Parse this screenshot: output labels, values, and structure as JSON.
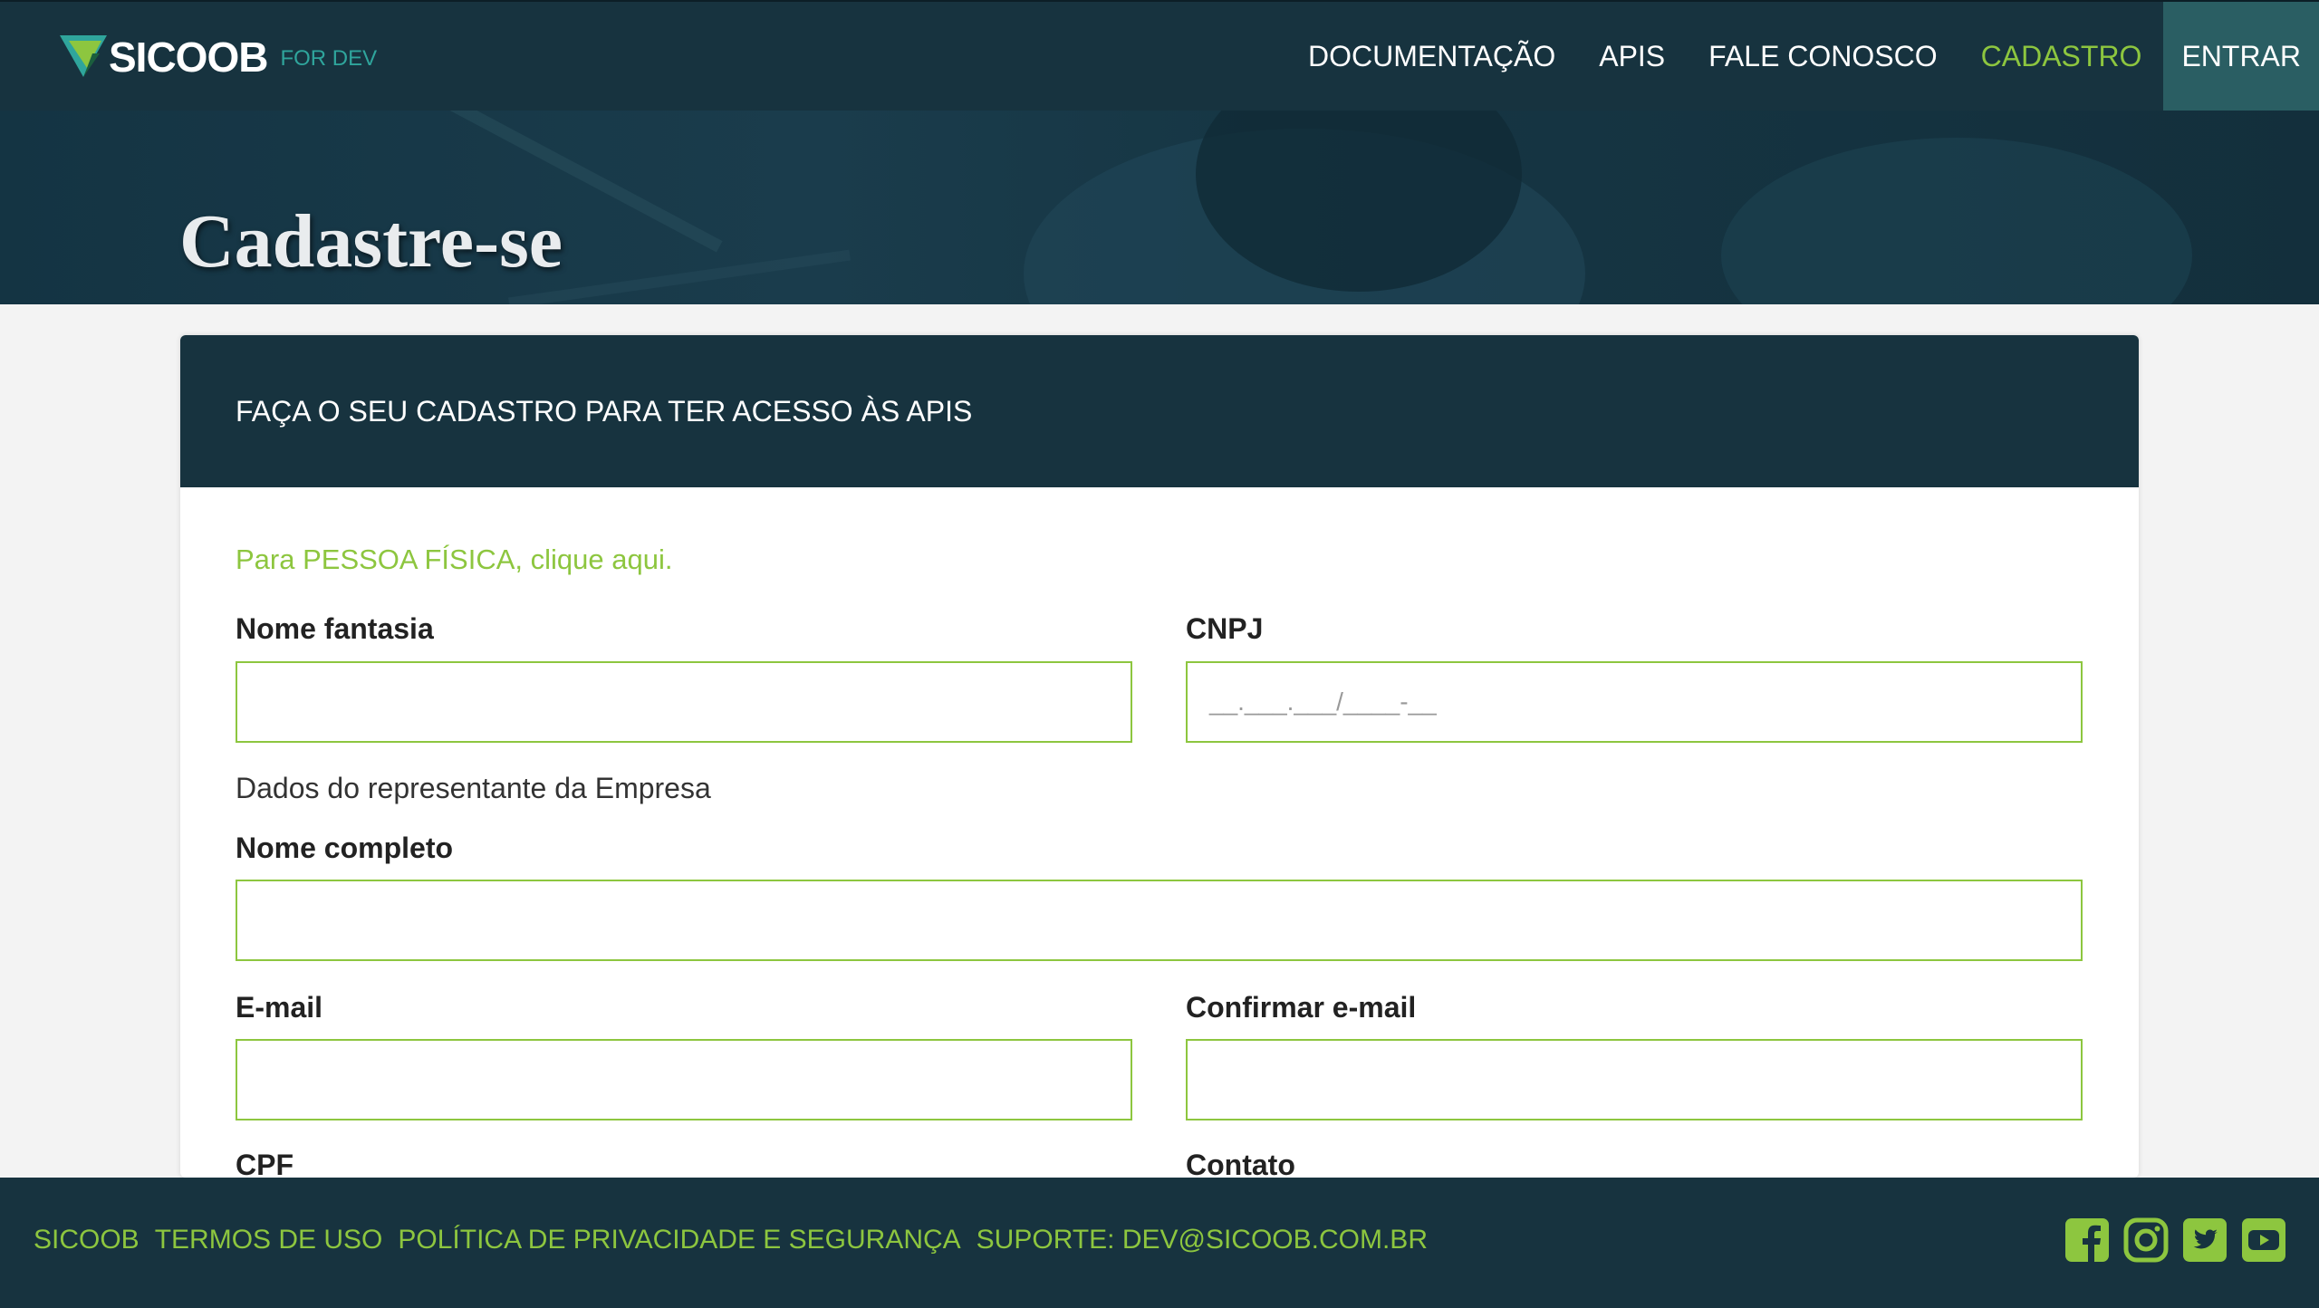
{
  "brand": {
    "name": "SICOOB",
    "subtitle": "FOR DEV",
    "colors": {
      "primary": "#17333f",
      "accent": "#8dc63f",
      "teal": "#2fa59c"
    }
  },
  "nav": {
    "items": [
      {
        "label": "DOCUMENTAÇÃO"
      },
      {
        "label": "APIS"
      },
      {
        "label": "FALE CONOSCO"
      },
      {
        "label": "CADASTRO"
      },
      {
        "label": "ENTRAR"
      }
    ]
  },
  "hero": {
    "title": "Cadastre-se"
  },
  "form": {
    "header": "FAÇA O SEU CADASTRO PARA TER ACESSO ÀS APIS",
    "pf_link": "Para PESSOA FÍSICA, clique aqui.",
    "fields": {
      "nome_fantasia": {
        "label": "Nome fantasia",
        "value": ""
      },
      "cnpj": {
        "label": "CNPJ",
        "value": "",
        "placeholder": "__.___.___/____-__"
      },
      "representante": "Dados do representante da Empresa",
      "nome_completo": {
        "label": "Nome completo",
        "value": ""
      },
      "email": {
        "label": "E-mail",
        "value": ""
      },
      "confirmar_email": {
        "label": "Confirmar e-mail",
        "value": ""
      },
      "cpf": {
        "label": "CPF"
      },
      "contato": {
        "label": "Contato"
      }
    }
  },
  "footer": {
    "links": [
      {
        "label": "SICOOB"
      },
      {
        "label": "TERMOS DE USO"
      },
      {
        "label": "POLÍTICA DE PRIVACIDADE E SEGURANÇA"
      },
      {
        "label": "SUPORTE: DEV@SICOOB.COM.BR"
      }
    ],
    "social": [
      "facebook-icon",
      "instagram-icon",
      "twitter-icon",
      "youtube-icon"
    ]
  }
}
